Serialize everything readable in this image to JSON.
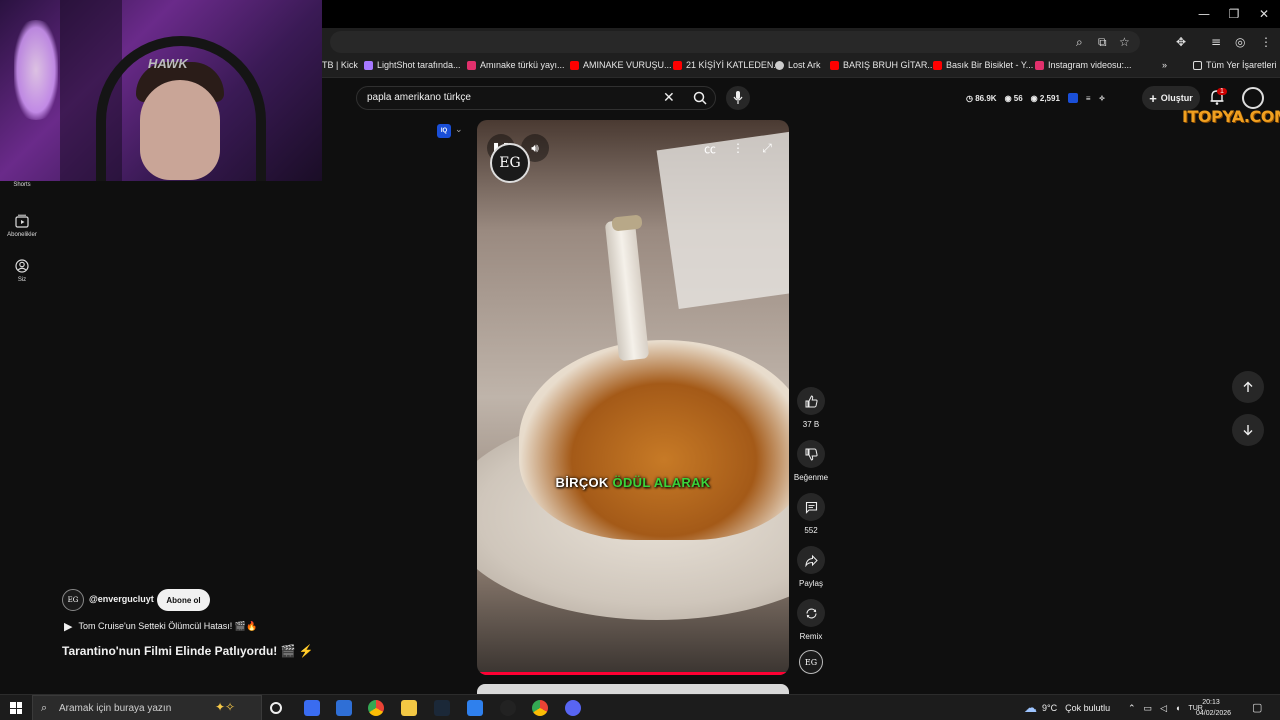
{
  "browser": {
    "bookmarks": [
      {
        "label": "TB | Kick",
        "icon": "kick-icon",
        "color": "#53fc18"
      },
      {
        "label": "LightShot tarafında...",
        "icon": "lightshot-icon",
        "color": "#a678ff"
      },
      {
        "label": "Amınake türkü yayı...",
        "icon": "instagram-icon",
        "color": "#e1306c"
      },
      {
        "label": "AMINAKE VURUŞU...",
        "icon": "youtube-icon",
        "color": "#ff0000"
      },
      {
        "label": "21 KİŞİYİ KATLEDEN...",
        "icon": "youtube-icon",
        "color": "#ff0000"
      },
      {
        "label": "Lost Ark",
        "icon": "globe-icon",
        "color": "#cccccc"
      },
      {
        "label": "BARIŞ BRUH GİTAR...",
        "icon": "youtube-icon",
        "color": "#ff0000"
      },
      {
        "label": "Basık Bir Bisiklet - Y...",
        "icon": "youtube-icon",
        "color": "#ff0000"
      },
      {
        "label": "Instagram videosu:...",
        "icon": "instagram-icon",
        "color": "#e1306c"
      }
    ],
    "all_bookmarks_label": "Tüm Yer İşaretleri",
    "more_label": "»"
  },
  "youtube": {
    "search": {
      "value": "papla amerikano türkçe"
    },
    "stats": {
      "views": "86.9K",
      "likes": "56",
      "comments": "2,591"
    },
    "create_label": "Oluştur",
    "notifications_count": "1",
    "watermark": "ITOPYA.COM",
    "sidebar": [
      {
        "label": "Shorts",
        "icon": "shorts-icon"
      },
      {
        "label": "Abonelikler",
        "icon": "subscriptions-icon"
      },
      {
        "label": "Siz",
        "icon": "user-icon"
      }
    ],
    "video": {
      "caption_word1": "BİRÇOK",
      "caption_word2": "ÖDÜL ALARAK",
      "logo_text": "EG",
      "progress": 0.99
    },
    "actions": {
      "likes": "37 B",
      "dislike_label": "Beğenme",
      "comments": "552",
      "share_label": "Paylaş",
      "remix_label": "Remix"
    },
    "channel": {
      "handle": "@envergucluyt",
      "subscribe_label": "Abone ol",
      "avatar_text": "EG"
    },
    "linked_video": "Tom Cruise'un Setteki Ölümcül Hatası! 🎬🔥",
    "title": "Tarantino'nun Filmi Elinde Patlıyordu! 🎬 ⚡",
    "iq_badge": "IQ"
  },
  "webcam": {
    "brand_text": "HAWK"
  },
  "taskbar": {
    "search_placeholder": "Aramak için buraya yazın",
    "weather": {
      "temp": "9°C",
      "desc": "Çok bulutlu"
    },
    "language": "TUR",
    "time": "20:13",
    "date": "04/02/2026"
  },
  "colors": {
    "accent": "#ff0033",
    "caption_highlight": "#3ad33a",
    "bg": "#0f0f0f"
  }
}
